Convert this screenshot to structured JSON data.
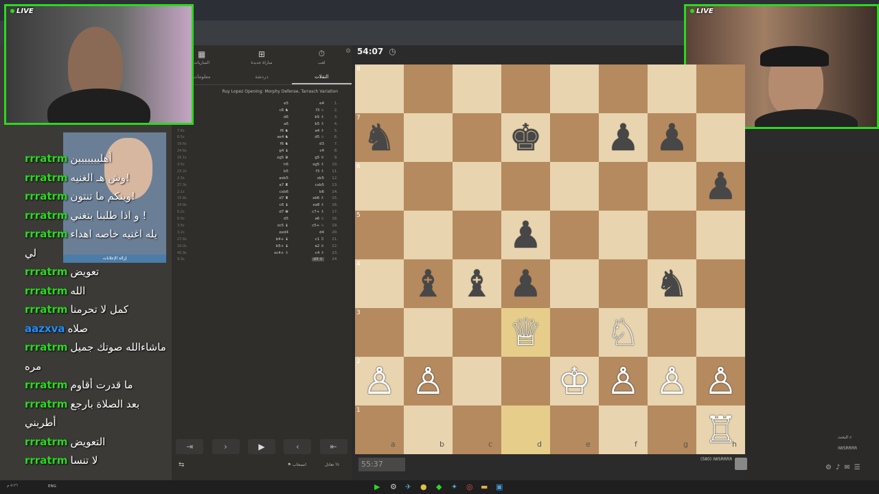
{
  "left_cam": {
    "live_label": "LIVE"
  },
  "right_cam": {
    "live_label": "LIVE"
  },
  "panel": {
    "tabs": [
      {
        "label": "لعب",
        "icon": "stopwatch-icon"
      },
      {
        "label": "مباراة جديدة",
        "icon": "plus-square-icon"
      },
      {
        "label": "المباريات",
        "icon": "grid-icon"
      }
    ],
    "subtabs": [
      "النقلات",
      "دردشة",
      "معلومات"
    ],
    "active_subtab": "النقلات",
    "opening": "Ruy Lopez Opening: Morphy Defense, Tarrasch Variation",
    "moves": [
      {
        "n": "1.",
        "w": "e4",
        "b": "e5",
        "t": ""
      },
      {
        "n": "2.",
        "w": "f3 ♘",
        "b": "c6 ♞",
        "t": ""
      },
      {
        "n": "3.",
        "w": "b5 ♗",
        "b": "d6",
        "t": ""
      },
      {
        "n": "4.",
        "w": "b5 ♗",
        "b": "a6",
        "t": "12.9s"
      },
      {
        "n": "5.",
        "w": "a4 ♗",
        "b": "f6 ♞",
        "t": "7.6s"
      },
      {
        "n": "6.",
        "w": "d5 ♘",
        "b": "xe4 ♞",
        "t": "6.5s"
      },
      {
        "n": "7.",
        "w": "d3",
        "b": "f6 ♞",
        "t": "19.6s"
      },
      {
        "n": "8.",
        "w": "c4",
        "b": "g4 ♝",
        "t": "24.6s"
      },
      {
        "n": "9.",
        "w": "g5 ♕",
        "b": "xg5 ♛",
        "t": "16.1s"
      },
      {
        "n": "10.",
        "w": "xg5 ♗",
        "b": "h6",
        "t": "3.5s"
      },
      {
        "n": "11.",
        "w": "f3 ♗",
        "b": "b5",
        "t": "23.2s"
      },
      {
        "n": "12.",
        "w": "xb5",
        "b": "axb5",
        "t": "2.3s"
      },
      {
        "n": "13.",
        "w": "cxb5",
        "b": "a7 ♜",
        "t": "27.3s"
      },
      {
        "n": "14.",
        "w": "b6",
        "b": "cxb6",
        "t": "2.1s"
      },
      {
        "n": "15.",
        "w": "xb6 ♗",
        "b": "d7 ♜",
        "t": "15.8s"
      },
      {
        "n": "16.",
        "w": "xa8 ♗",
        "b": "c6 ♝",
        "t": "24.9s"
      },
      {
        "n": "17.",
        "w": "c7+ ♗",
        "b": "d7 ♚",
        "t": "6.2s"
      },
      {
        "n": "18.",
        "w": "a6 ♘",
        "b": "d5",
        "t": "6.0s"
      },
      {
        "n": "19.",
        "w": "c5+ ♘",
        "b": "xc5 ♝",
        "t": "3.5s"
      },
      {
        "n": "20.",
        "w": "d4",
        "b": "exd4",
        "t": "3.2s"
      },
      {
        "n": "21.",
        "w": "c1 ♖",
        "b": "b4+ ♝",
        "t": "27.6s"
      },
      {
        "n": "22.",
        "w": "a2 ♕",
        "b": "b5+ ♝",
        "t": "16.0s"
      },
      {
        "n": "23.",
        "w": "c4 ♗",
        "b": "xc4+ ♗",
        "t": "40.9s"
      },
      {
        "n": "24.",
        "w": "d3 ♕",
        "b": "",
        "t": "9.3s"
      }
    ],
    "draw_label": "تعادل",
    "resign_label": "انسحاب",
    "half_label": "½"
  },
  "chat": [
    {
      "user": "rrratrm",
      "text": "أهلييييييين",
      "color": "#2bd91e"
    },
    {
      "user": "rrratrm",
      "text": "وش هـ الغنيه!",
      "color": "#2bd91e"
    },
    {
      "user": "rrratrm",
      "text": "وينكم ما تنتون!",
      "color": "#2bd91e"
    },
    {
      "user": "rrratrm",
      "text": "و اذا طلبنا بتغني !",
      "color": "#2bd91e"
    },
    {
      "user": "rrratrm",
      "text": "يله اغنيه خاصه اهداء لي",
      "color": "#2bd91e"
    },
    {
      "user": "rrratrm",
      "text": "تعويض",
      "color": "#2bd91e"
    },
    {
      "user": "rrratrm",
      "text": "الله",
      "color": "#2bd91e"
    },
    {
      "user": "rrratrm",
      "text": "كمل لا تحرمنا",
      "color": "#2bd91e"
    },
    {
      "user": "aazxva",
      "text": "صلاه",
      "color": "#1e90ff"
    },
    {
      "user": "rrratrm",
      "text": "ماشاءالله صوتك جميل مره",
      "color": "#2bd91e"
    },
    {
      "user": "rrratrm",
      "text": "ما قدرت أقاوم",
      "color": "#2bd91e"
    },
    {
      "user": "rrratrm",
      "text": "بعد الصلاة بارجع أطربني",
      "color": "#2bd91e"
    },
    {
      "user": "rrratrm",
      "text": "التعويض",
      "color": "#2bd91e"
    },
    {
      "user": "rrratrm",
      "text": "لا تنسا",
      "color": "#2bd91e"
    }
  ],
  "ad": {
    "remove_label": "إزالة الإعلانات"
  },
  "board": {
    "ranks": [
      "8",
      "7",
      "6",
      "5",
      "4",
      "3",
      "2",
      "1"
    ],
    "files": [
      "a",
      "b",
      "c",
      "d",
      "e",
      "f",
      "g",
      "h"
    ],
    "pieces": [
      {
        "sq": "a7",
        "p": "♞",
        "c": "bk"
      },
      {
        "sq": "d7",
        "p": "♚",
        "c": "bk"
      },
      {
        "sq": "f7",
        "p": "♟",
        "c": "bk"
      },
      {
        "sq": "g7",
        "p": "♟",
        "c": "bk"
      },
      {
        "sq": "h6",
        "p": "♟",
        "c": "bk"
      },
      {
        "sq": "d5",
        "p": "♟",
        "c": "bk"
      },
      {
        "sq": "b4",
        "p": "♝",
        "c": "bk"
      },
      {
        "sq": "c4",
        "p": "♝",
        "c": "bk"
      },
      {
        "sq": "d4",
        "p": "♟",
        "c": "bk"
      },
      {
        "sq": "g4",
        "p": "♞",
        "c": "bk"
      },
      {
        "sq": "d3",
        "p": "♕",
        "c": "wh"
      },
      {
        "sq": "f3",
        "p": "♘",
        "c": "wh"
      },
      {
        "sq": "a2",
        "p": "♙",
        "c": "wh"
      },
      {
        "sq": "b2",
        "p": "♙",
        "c": "wh"
      },
      {
        "sq": "e2",
        "p": "♔",
        "c": "wh"
      },
      {
        "sq": "f2",
        "p": "♙",
        "c": "wh"
      },
      {
        "sq": "g2",
        "p": "♙",
        "c": "wh"
      },
      {
        "sq": "h2",
        "p": "♙",
        "c": "wh"
      },
      {
        "sq": "h1",
        "p": "♖",
        "c": "wh"
      }
    ],
    "highlight": [
      "d3",
      "d1"
    ]
  },
  "clock_top": "54:07",
  "clock_bottom": "55:37",
  "player": {
    "name": "IWSRRRR",
    "rating": "(580)"
  },
  "right_links": {
    "search": "البحث",
    "user": "IWSRRRR"
  },
  "taskbar": {
    "lang": "ENG",
    "time": "٥:٢٦ م"
  }
}
